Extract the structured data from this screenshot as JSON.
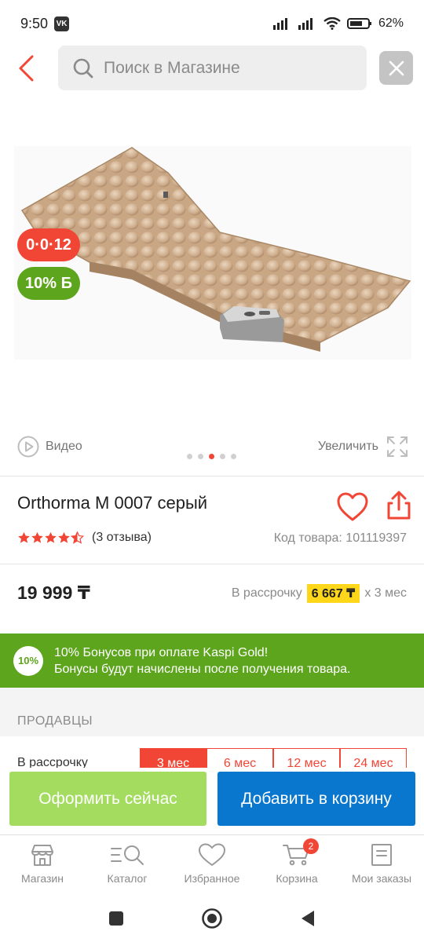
{
  "status_bar": {
    "time": "9:50",
    "vk": "VK",
    "battery": "62%"
  },
  "search": {
    "placeholder": "Поиск в Магазине"
  },
  "product": {
    "promo_red": "0·0·12",
    "promo_green": "10% Б",
    "video_label": "Видео",
    "zoom_label": "Увеличить",
    "image_dots": 5,
    "active_dot": 2,
    "title": "Orthorma M 0007 серый",
    "rating": 4.5,
    "reviews": "(3 отзыва)",
    "sku": "Код товара: 101119397",
    "price": "19 999 ₸",
    "installment_prefix": "В рассрочку",
    "installment_amount": "6 667 ₸",
    "installment_suffix": "x 3 мес"
  },
  "bonus": {
    "badge": "10%",
    "line1": "10% Бонусов при оплате Kaspi Gold!",
    "line2": "Бонусы будут начислены после получения товара."
  },
  "sellers": {
    "heading": "ПРОДАВЦЫ",
    "installment_label": "В рассрочку",
    "terms": [
      "3 мес",
      "6 мес",
      "12 мес",
      "24 мес"
    ]
  },
  "actions": {
    "checkout": "Оформить сейчас",
    "add_to_cart": "Добавить в корзину"
  },
  "nav": {
    "items": [
      {
        "label": "Магазин",
        "icon": "store-icon"
      },
      {
        "label": "Каталог",
        "icon": "catalog-search-icon"
      },
      {
        "label": "Избранное",
        "icon": "heart-icon"
      },
      {
        "label": "Корзина",
        "icon": "cart-icon"
      },
      {
        "label": "Мои заказы",
        "icon": "orders-icon"
      }
    ],
    "cart_count": "2"
  },
  "colors": {
    "accent_red": "#f14635",
    "bonus_green": "#5ea51e",
    "checkout_green": "#a3dc5f",
    "cart_blue": "#0a77cf",
    "installment_yellow": "#ffd71a"
  }
}
